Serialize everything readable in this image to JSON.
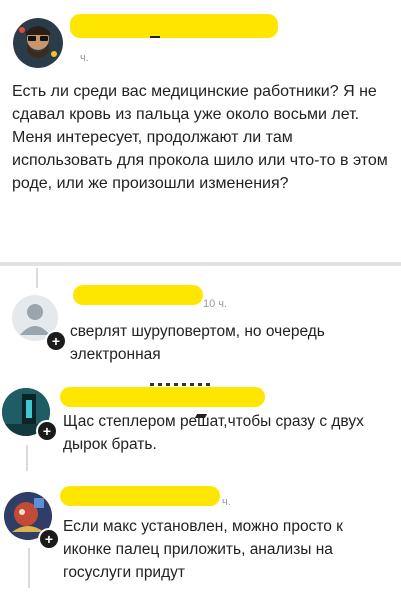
{
  "post": {
    "time": "ч.",
    "paragraphs": [
      "Есть ли среди вас медицинские работники? Я не сдавал кровь из пальца уже около восьми лет.",
      "Меня интересует, продолжают ли там использовать для прокола шило или что-то в этом роде, или же произошли изменения?"
    ]
  },
  "comments": [
    {
      "time": "10 ч.",
      "text": "сверлят шуруповертом, но очередь электронная"
    },
    {
      "time": "",
      "text": "Щас степлером решат,чтобы сразу с двух дырок брать."
    },
    {
      "time": "ч.",
      "text": "Если макс установлен, можно просто к иконке палец приложить, анализы на госуслуги придут"
    }
  ],
  "badge_symbol": "+",
  "colors": {
    "redaction": "#ffe600",
    "separator": "#e2e2e2",
    "thread": "#dadada"
  }
}
